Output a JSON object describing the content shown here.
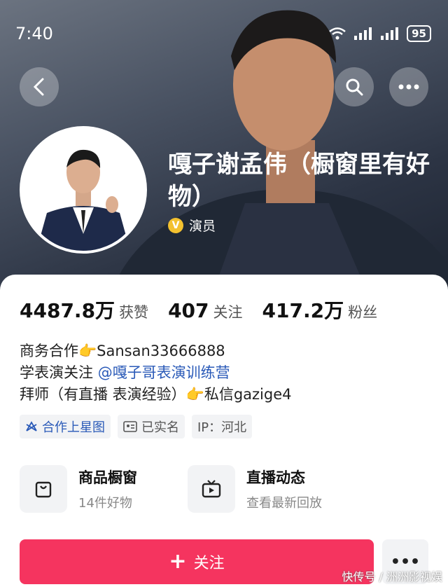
{
  "status_bar": {
    "time": "7:40",
    "battery": "95"
  },
  "profile": {
    "name": "嘎子谢孟伟（橱窗里有好物）",
    "verified_badge": "V",
    "verified_role": "演员"
  },
  "stats": [
    {
      "value": "4487.8万",
      "label": "获赞"
    },
    {
      "value": "407",
      "label": "关注"
    },
    {
      "value": "417.2万",
      "label": "粉丝"
    }
  ],
  "bio": {
    "line1_prefix": "商务合作👉Sansan33666888",
    "line2_prefix": "学表演关注 ",
    "line2_link": "@嘎子哥表演训练营",
    "line3": "拜师（有直播 表演经验）👉私信gazige4"
  },
  "tags": {
    "star": "合作上星图",
    "realname": "已实名",
    "ip": "IP：河北"
  },
  "features": [
    {
      "title": "商品橱窗",
      "subtitle": "14件好物"
    },
    {
      "title": "直播动态",
      "subtitle": "查看最新回放"
    }
  ],
  "actions": {
    "follow_label": "关注",
    "follow_icon": "+",
    "more_label": "•••"
  },
  "watermark": "快传号 / 洲洲影视娱",
  "colors": {
    "accent": "#f5345f",
    "link": "#2a5ab8",
    "verified": "#f3c12f"
  }
}
